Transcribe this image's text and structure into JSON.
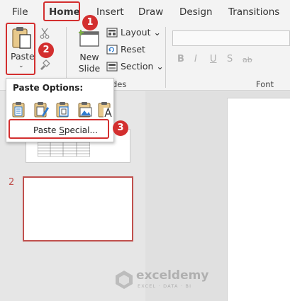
{
  "menu": {
    "tabs": [
      "File",
      "Home",
      "Insert",
      "Draw",
      "Design",
      "Transitions"
    ]
  },
  "ribbon": {
    "paste_label": "Paste",
    "paste_caret": "⌄",
    "new_slide_label_line1": "New",
    "new_slide_label_line2": "Slide ⌄",
    "layout_label": "Layout ⌄",
    "reset_label": "Reset",
    "section_label": "Section ⌄",
    "slides_group_label": "des",
    "font_group_label": "Font",
    "font_buttons": [
      "B",
      "I",
      "U",
      "S",
      "ab"
    ]
  },
  "popup": {
    "title": "Paste Options:",
    "paste_special_label": "Paste Special..."
  },
  "thumbnails": {
    "slide2_number": "2"
  },
  "annotations": {
    "badges": [
      "1",
      "2",
      "3"
    ]
  },
  "watermark": {
    "name": "exceldemy",
    "tagline": "EXCEL · DATA · BI"
  },
  "colors": {
    "highlight": "#d32f2f",
    "selected_slide_border": "#c0504d",
    "ribbon_bg": "#f3f3f3"
  }
}
